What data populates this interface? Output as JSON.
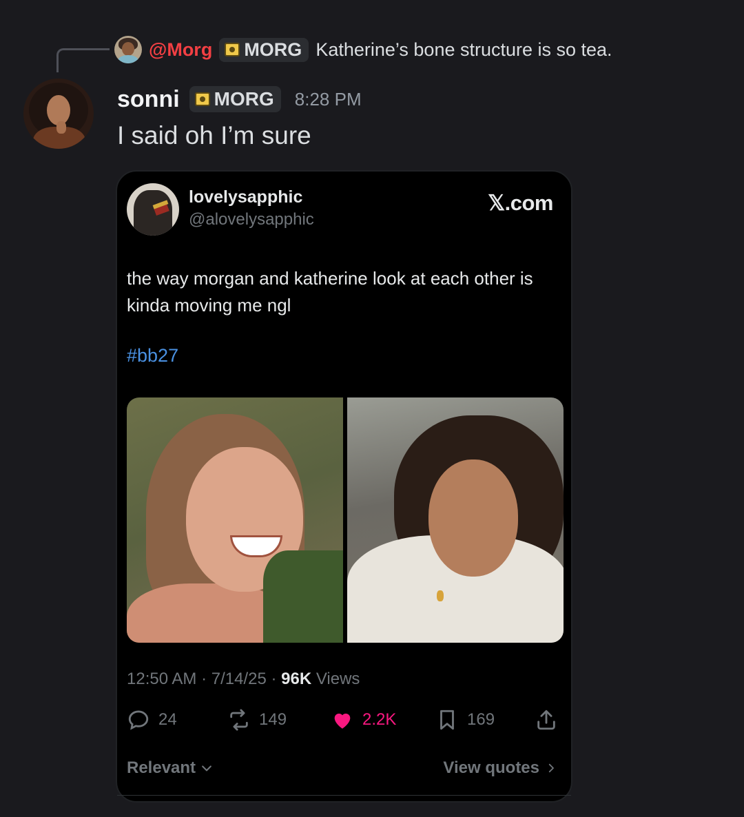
{
  "reply": {
    "author": "@Morg",
    "tag": "MORG",
    "text": "Katherine’s bone structure is so tea."
  },
  "message": {
    "username": "sonni",
    "tag": "MORG",
    "time": "8:28 PM",
    "text": "I said oh I’m sure"
  },
  "embed": {
    "author_name": "lovelysapphic",
    "author_handle": "@alovelysapphic",
    "site": "𝕏.com",
    "text": "the way morgan and katherine look at each other is kinda moving me ngl",
    "hashtag": "#bb27",
    "meta_time": "12:50 AM · 7/14/25 · ",
    "views_count": "96K",
    "views_label": " Views",
    "replies": "24",
    "reposts": "149",
    "likes": "2.2K",
    "bookmarks": "169",
    "footer_left": "Relevant",
    "footer_right": "View quotes"
  },
  "colors": {
    "background": "#1a1a1e",
    "reply_author": "#f23f43",
    "hashtag": "#4a91e2",
    "like": "#f91880",
    "muted": "#71767b"
  }
}
